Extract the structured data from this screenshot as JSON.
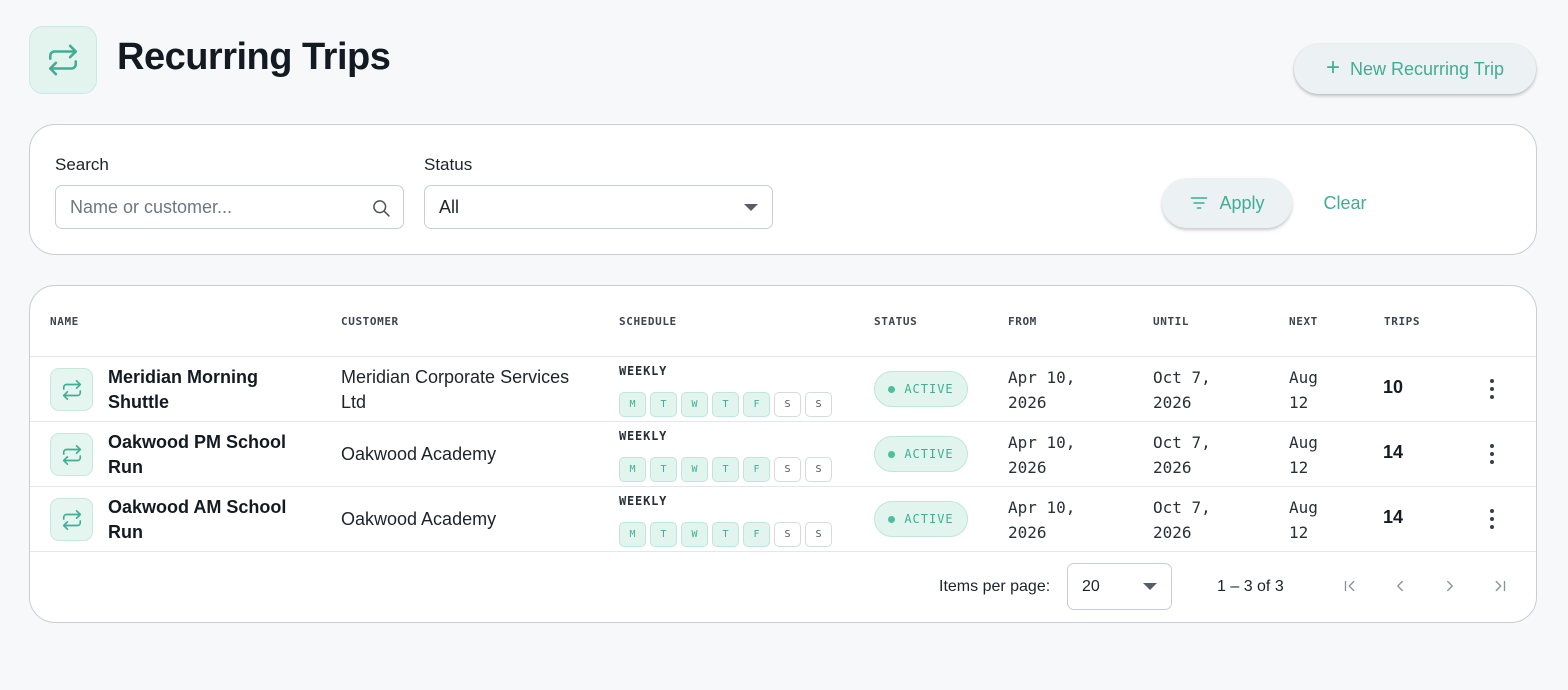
{
  "header": {
    "title": "Recurring Trips",
    "new_button_label": "New Recurring Trip"
  },
  "filters": {
    "search_label": "Search",
    "search_placeholder": "Name or customer...",
    "search_value": "",
    "status_label": "Status",
    "status_value": "All",
    "apply_label": "Apply",
    "clear_label": "Clear"
  },
  "table": {
    "columns": [
      "NAME",
      "CUSTOMER",
      "SCHEDULE",
      "STATUS",
      "FROM",
      "UNTIL",
      "NEXT",
      "TRIPS"
    ],
    "rows": [
      {
        "name": "Meridian Morning Shuttle",
        "customer": "Meridian Corporate Services Ltd",
        "schedule": "WEEKLY",
        "days": [
          {
            "label": "M",
            "active": true
          },
          {
            "label": "T",
            "active": true
          },
          {
            "label": "W",
            "active": true
          },
          {
            "label": "T",
            "active": true
          },
          {
            "label": "F",
            "active": true
          },
          {
            "label": "S",
            "active": false
          },
          {
            "label": "S",
            "active": false
          }
        ],
        "status": "ACTIVE",
        "from": "Apr 10, 2026",
        "until": "Oct 7, 2026",
        "next": "Aug 12",
        "trips": "10"
      },
      {
        "name": "Oakwood PM School Run",
        "customer": "Oakwood Academy",
        "schedule": "WEEKLY",
        "days": [
          {
            "label": "M",
            "active": true
          },
          {
            "label": "T",
            "active": true
          },
          {
            "label": "W",
            "active": true
          },
          {
            "label": "T",
            "active": true
          },
          {
            "label": "F",
            "active": true
          },
          {
            "label": "S",
            "active": false
          },
          {
            "label": "S",
            "active": false
          }
        ],
        "status": "ACTIVE",
        "from": "Apr 10, 2026",
        "until": "Oct 7, 2026",
        "next": "Aug 12",
        "trips": "14"
      },
      {
        "name": "Oakwood AM School Run",
        "customer": "Oakwood Academy",
        "schedule": "WEEKLY",
        "days": [
          {
            "label": "M",
            "active": true
          },
          {
            "label": "T",
            "active": true
          },
          {
            "label": "W",
            "active": true
          },
          {
            "label": "T",
            "active": true
          },
          {
            "label": "F",
            "active": true
          },
          {
            "label": "S",
            "active": false
          },
          {
            "label": "S",
            "active": false
          }
        ],
        "status": "ACTIVE",
        "from": "Apr 10, 2026",
        "until": "Oct 7, 2026",
        "next": "Aug 12",
        "trips": "14"
      }
    ]
  },
  "paginator": {
    "items_per_page_label": "Items per page:",
    "items_per_page_value": "20",
    "range_label": "1 – 3 of 3"
  },
  "icons": {
    "header": "repeat-icon",
    "row": "repeat-icon",
    "search": "search-icon",
    "apply": "filter-lines-icon",
    "new": "plus-icon",
    "more": "more-vertical-icon"
  },
  "colors": {
    "accent": "#3fae94",
    "accent_light": "#e2f4ee",
    "background": "#f6f8fa",
    "text": "#141a22"
  }
}
